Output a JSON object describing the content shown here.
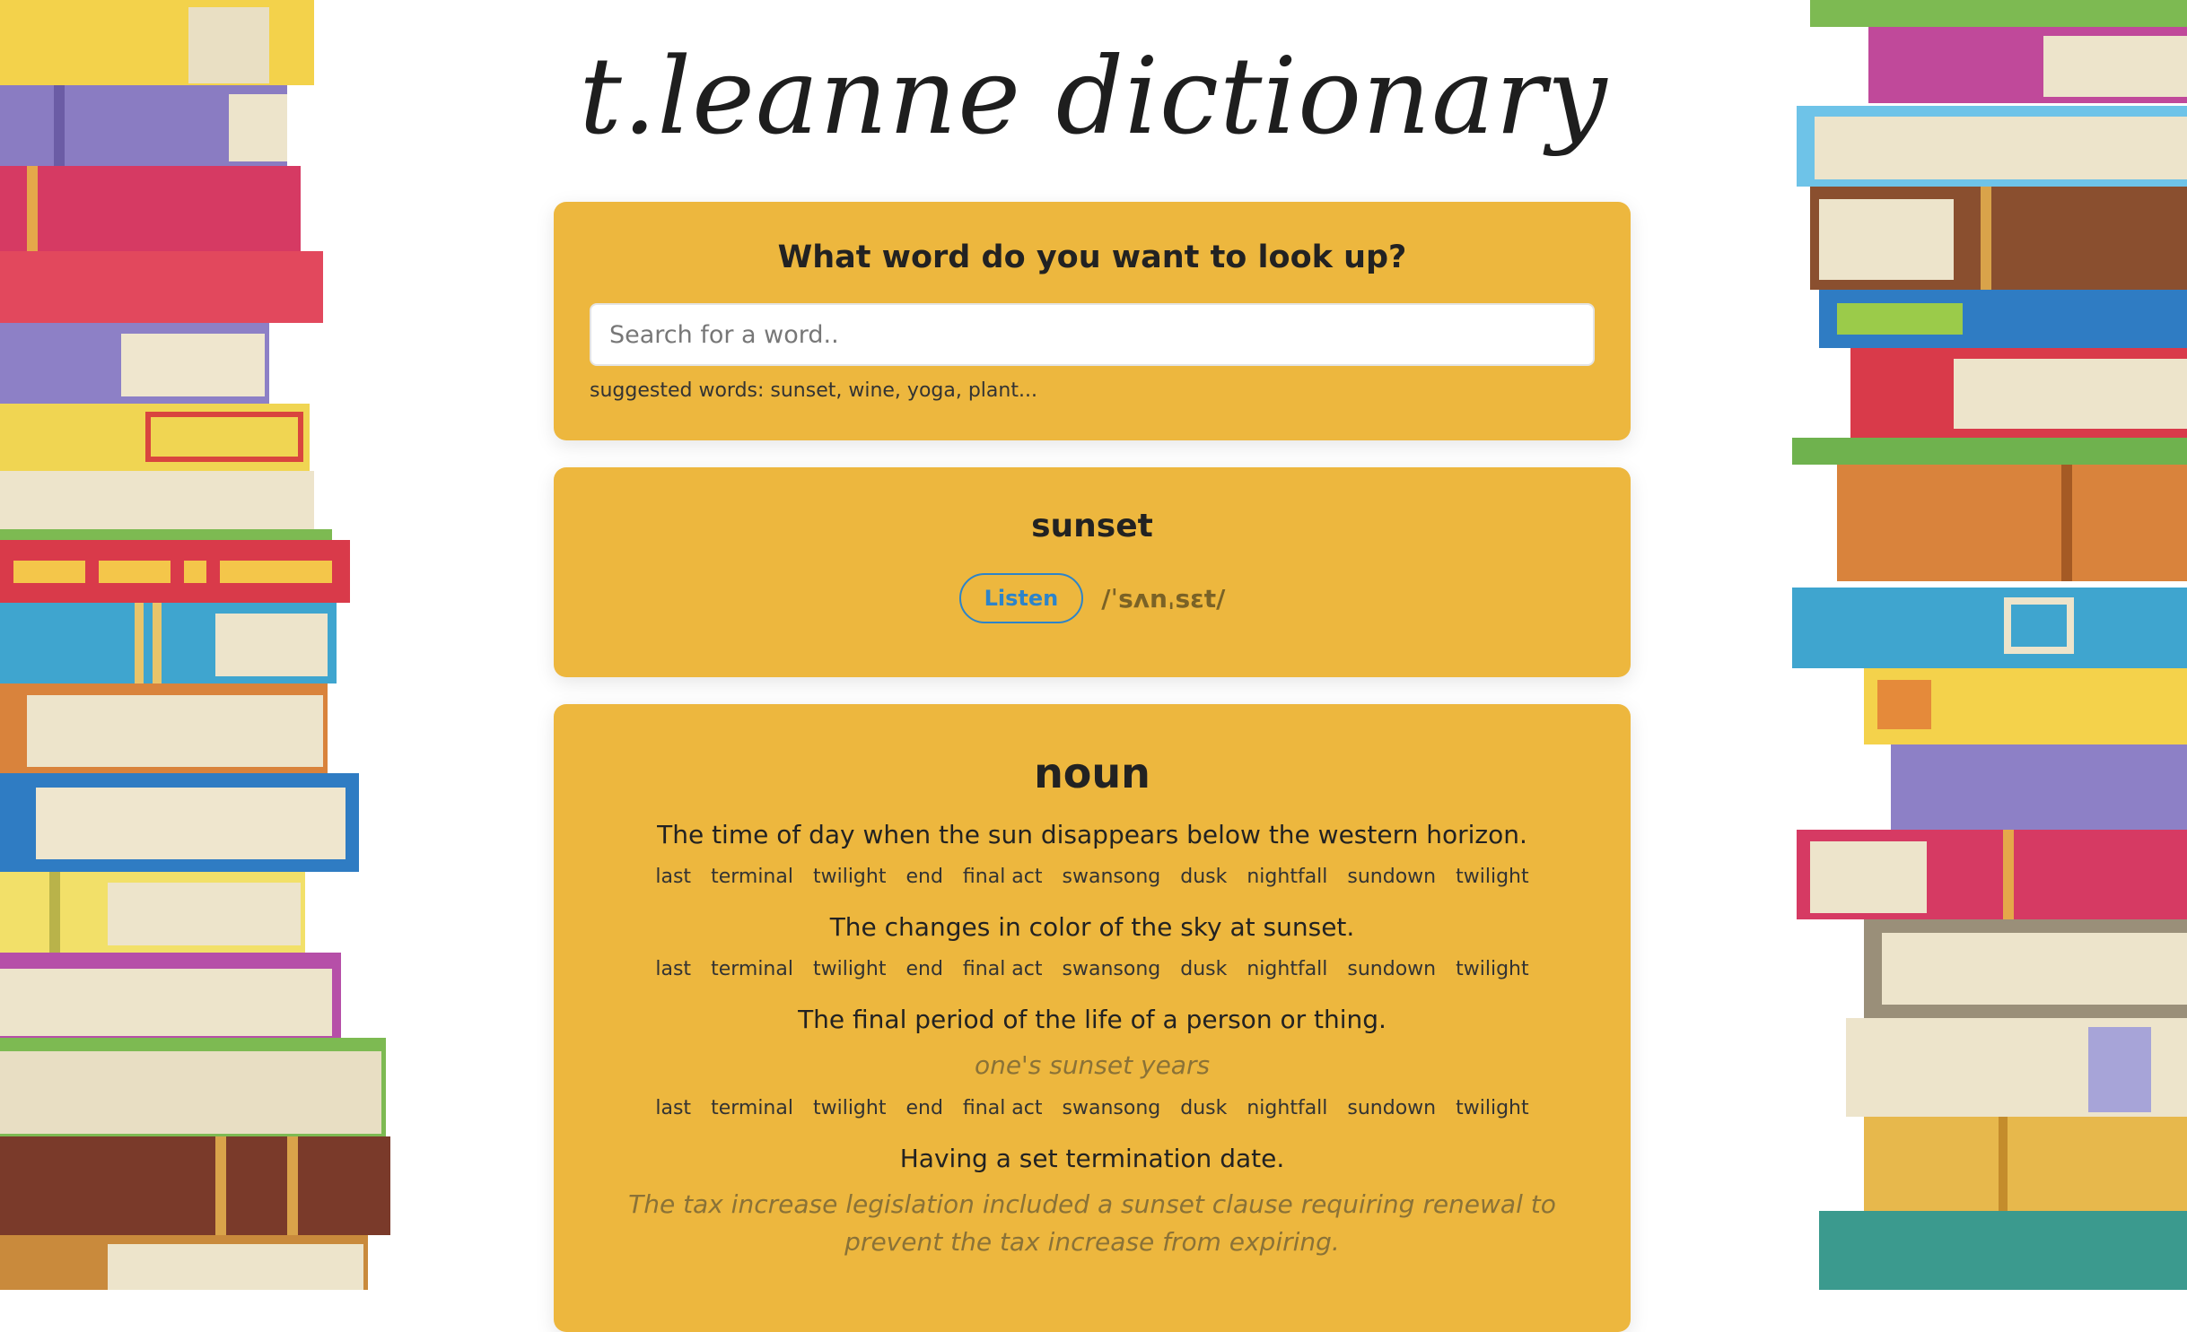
{
  "logo": "t.leanne dictionary",
  "search": {
    "heading": "What word do you want to look up?",
    "placeholder": "Search for a word..",
    "suggestions": "suggested words: sunset, wine, yoga, plant..."
  },
  "word": {
    "title": "sunset",
    "listen_label": "Listen",
    "phonetic": "/ˈsʌnˌsɛt/"
  },
  "meanings": {
    "part_of_speech": "noun",
    "definitions": [
      {
        "text": "The time of day when the sun disappears below the western horizon.",
        "example": "",
        "synonyms": [
          "last",
          "terminal",
          "twilight",
          "end",
          "final act",
          "swansong",
          "dusk",
          "nightfall",
          "sundown",
          "twilight"
        ]
      },
      {
        "text": "The changes in color of the sky at sunset.",
        "example": "",
        "synonyms": [
          "last",
          "terminal",
          "twilight",
          "end",
          "final act",
          "swansong",
          "dusk",
          "nightfall",
          "sundown",
          "twilight"
        ]
      },
      {
        "text": "The final period of the life of a person or thing.",
        "example": "one's sunset years",
        "synonyms": [
          "last",
          "terminal",
          "twilight",
          "end",
          "final act",
          "swansong",
          "dusk",
          "nightfall",
          "sundown",
          "twilight"
        ]
      },
      {
        "text": "Having a set termination date.",
        "example": "The tax increase legislation included a sunset clause requiring renewal to prevent the tax increase from expiring.",
        "synonyms": []
      }
    ]
  },
  "colors": {
    "card": "#EDB73E",
    "listen": "#2d84c9"
  }
}
